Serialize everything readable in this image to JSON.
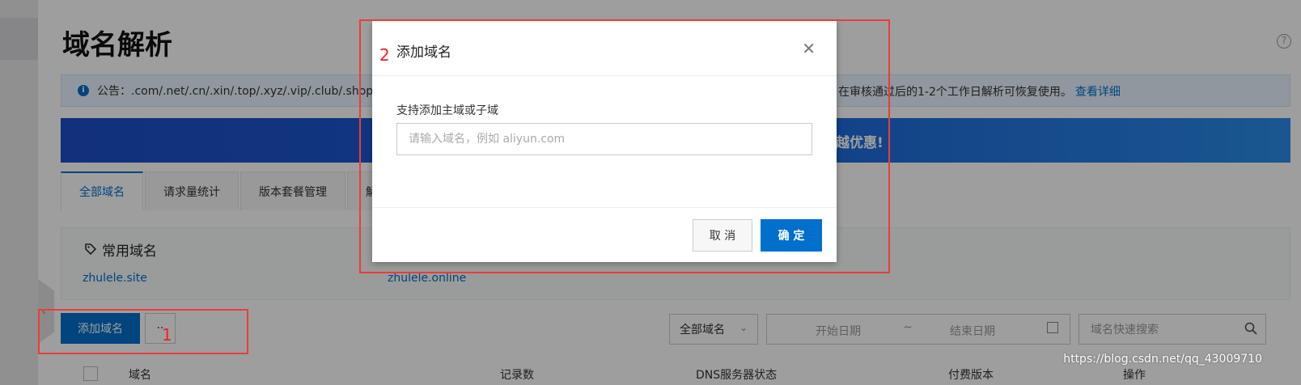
{
  "page": {
    "title": "域名解析",
    "help_icon": "?",
    "notice": {
      "text": "公告：.com/.net/.cn/.xin/.top/.xyz/.vip/.club/.shop/.",
      "text_right": "在审核通过后的1-2个工作日解析可恢复使用。",
      "link": "查看详细"
    },
    "banner": {
      "text": "越优惠!"
    },
    "tabs": [
      {
        "label": "全部域名"
      },
      {
        "label": "请求量统计"
      },
      {
        "label": "版本套餐管理"
      },
      {
        "label": "解"
      }
    ],
    "common_domains": {
      "title": "常用域名",
      "items": [
        "zhulele.site",
        "zhulele.online"
      ]
    },
    "toolbar": {
      "add_label": "添加域名",
      "more_label": "··",
      "filter_selected": "全部域名",
      "date_start": "开始日期",
      "date_sep": "~",
      "date_end": "结束日期",
      "search_placeholder": "域名快速搜索"
    },
    "table": {
      "headers": [
        "域名",
        "记录数",
        "DNS服务器状态",
        "付费版本",
        "操作"
      ]
    },
    "watermark": "https://blog.csdn.net/qq_43009710"
  },
  "modal": {
    "title": "添加域名",
    "field_label": "支持添加主域或子域",
    "input_placeholder": "请输入域名，例如 aliyun.com",
    "cancel_label": "取 消",
    "ok_label": "确 定"
  },
  "annotations": [
    {
      "label": "1"
    },
    {
      "label": "2"
    }
  ],
  "colors": {
    "primary": "#0070cc",
    "annotation_red": "#ee3b3b",
    "banner_blue": "#1e4ec7"
  }
}
